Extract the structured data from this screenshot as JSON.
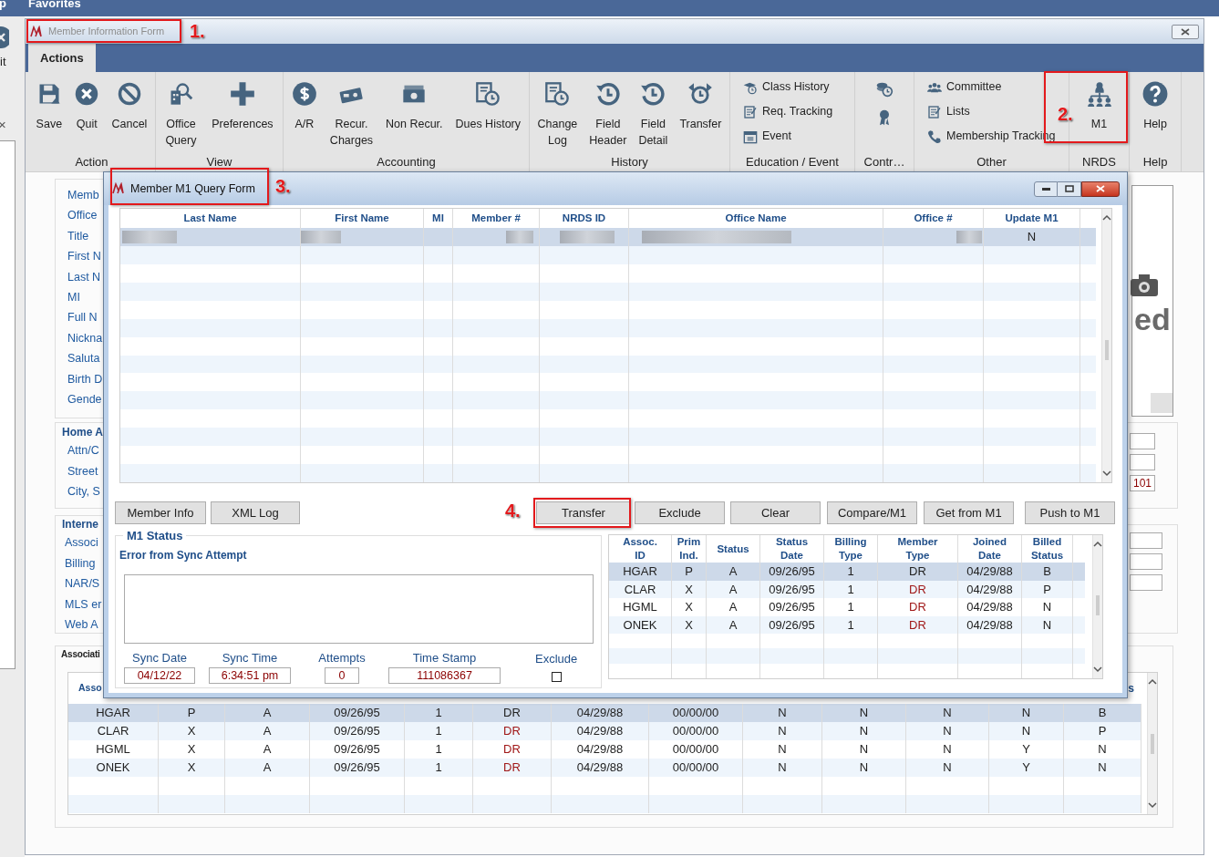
{
  "app_bar": {
    "items": [
      "p",
      "Favorites"
    ]
  },
  "background_window": {
    "label": "it",
    "close": "×"
  },
  "window": {
    "title": "Member Information Form"
  },
  "ribbon": {
    "tabs": [
      {
        "label": "Actions",
        "selected": true
      }
    ],
    "groups": [
      {
        "label": "Action",
        "items": [
          {
            "kind": "large",
            "label": "Save"
          },
          {
            "kind": "large",
            "label": "Quit"
          },
          {
            "kind": "large",
            "label": "Cancel"
          }
        ]
      },
      {
        "label": "View",
        "items": [
          {
            "kind": "large",
            "label": "Office\nQuery"
          },
          {
            "kind": "large",
            "label": "Preferences"
          }
        ]
      },
      {
        "label": "Accounting",
        "items": [
          {
            "kind": "large",
            "label": "A/R"
          },
          {
            "kind": "large",
            "label": "Recur.\nCharges"
          },
          {
            "kind": "large",
            "label": "Non Recur."
          },
          {
            "kind": "large",
            "label": "Dues History"
          }
        ]
      },
      {
        "label": "History",
        "items": [
          {
            "kind": "large",
            "label": "Change\nLog"
          },
          {
            "kind": "large",
            "label": "Field\nHeader"
          },
          {
            "kind": "large",
            "label": "Field\nDetail"
          },
          {
            "kind": "large",
            "label": "Transfer"
          }
        ]
      },
      {
        "label": "Education / Event",
        "items": [
          {
            "kind": "small",
            "label": "Class History"
          },
          {
            "kind": "small",
            "label": "Req. Tracking"
          },
          {
            "kind": "small",
            "label": "Event"
          }
        ]
      },
      {
        "label": "Contr…",
        "items": [
          {
            "kind": "icon"
          },
          {
            "kind": "icon"
          }
        ]
      },
      {
        "label": "Other",
        "items": [
          {
            "kind": "small",
            "label": "Committee"
          },
          {
            "kind": "small",
            "label": "Lists"
          },
          {
            "kind": "small",
            "label": "Membership Tracking"
          }
        ]
      },
      {
        "label": "NRDS",
        "items": [
          {
            "kind": "large",
            "label": "M1"
          }
        ]
      },
      {
        "label": "Help",
        "items": [
          {
            "kind": "large",
            "label": "Help"
          }
        ]
      }
    ]
  },
  "form": {
    "personal_labels": [
      "Memb",
      "Office",
      "Title",
      "First N",
      "Last N",
      "MI",
      "Full N",
      "Nickna",
      "Saluta",
      "Birth D",
      "Gende"
    ],
    "photo_text": "ed",
    "home_legend": "Home A",
    "home_labels": [
      "Attn/C",
      "Street",
      "City, S"
    ],
    "home_field_value": "101",
    "internet_legend": "Interne",
    "internet_labels": [
      "Associ",
      "Billing",
      "NAR/S",
      "MLS er",
      "Web A"
    ],
    "association_legend": "Associati",
    "association_table": {
      "header_first": "Asso",
      "header_last": "s",
      "rows": [
        {
          "selected": true,
          "cells": [
            "HGAR",
            "P",
            "A",
            "09/26/95",
            "1",
            "DR",
            "04/29/88",
            "00/00/00",
            "N",
            "N",
            "N",
            "N",
            "B"
          ]
        },
        {
          "selected": false,
          "cells": [
            "CLAR",
            "X",
            "A",
            "09/26/95",
            "1",
            "DR",
            "04/29/88",
            "00/00/00",
            "N",
            "N",
            "N",
            "N",
            "P"
          ]
        },
        {
          "selected": false,
          "cells": [
            "HGML",
            "X",
            "A",
            "09/26/95",
            "1",
            "DR",
            "04/29/88",
            "00/00/00",
            "N",
            "N",
            "N",
            "Y",
            "N"
          ]
        },
        {
          "selected": false,
          "cells": [
            "ONEK",
            "X",
            "A",
            "09/26/95",
            "1",
            "DR",
            "04/29/88",
            "00/00/00",
            "N",
            "N",
            "N",
            "Y",
            "N"
          ]
        }
      ]
    }
  },
  "dialog": {
    "title": "Member M1 Query Form",
    "query_grid": {
      "columns": [
        "Last Name",
        "First Name",
        "MI",
        "Member #",
        "NRDS ID",
        "Office Name",
        "Office #",
        "Update M1"
      ],
      "rows": [
        {
          "selected": true,
          "redacted": true,
          "update_m1": "N"
        }
      ]
    },
    "left_buttons": [
      "Member Info",
      "XML Log"
    ],
    "right_buttons": [
      "Transfer",
      "Exclude",
      "Clear",
      "Compare/M1",
      "Get from M1",
      "Push to M1"
    ],
    "status": {
      "legend": "M1 Status",
      "error_label": "Error from Sync Attempt",
      "fields": [
        {
          "label": "Sync Date",
          "value": "04/12/22"
        },
        {
          "label": "Sync Time",
          "value": "6:34:51 pm"
        },
        {
          "label": "Attempts",
          "value": "0"
        },
        {
          "label": "Time Stamp",
          "value": "111086367"
        }
      ],
      "exclude": {
        "label": "Exclude",
        "checked": false
      }
    },
    "assoc_grid": {
      "columns": [
        "Assoc.\nID",
        "Prim\nInd.",
        "Status",
        "Status\nDate",
        "Billing\nType",
        "Member\nType",
        "Joined\nDate",
        "Billed\nStatus"
      ],
      "rows": [
        {
          "selected": true,
          "cells": [
            "HGAR",
            "P",
            "A",
            "09/26/95",
            "1",
            "DR",
            "04/29/88",
            "B"
          ]
        },
        {
          "selected": false,
          "cells": [
            "CLAR",
            "X",
            "A",
            "09/26/95",
            "1",
            "DR",
            "04/29/88",
            "P"
          ]
        },
        {
          "selected": false,
          "cells": [
            "HGML",
            "X",
            "A",
            "09/26/95",
            "1",
            "DR",
            "04/29/88",
            "N"
          ]
        },
        {
          "selected": false,
          "cells": [
            "ONEK",
            "X",
            "A",
            "09/26/95",
            "1",
            "DR",
            "04/29/88",
            "N"
          ]
        }
      ]
    }
  },
  "annotations": [
    {
      "label": "1."
    },
    {
      "label": "2."
    },
    {
      "label": "3."
    },
    {
      "label": "4."
    }
  ]
}
